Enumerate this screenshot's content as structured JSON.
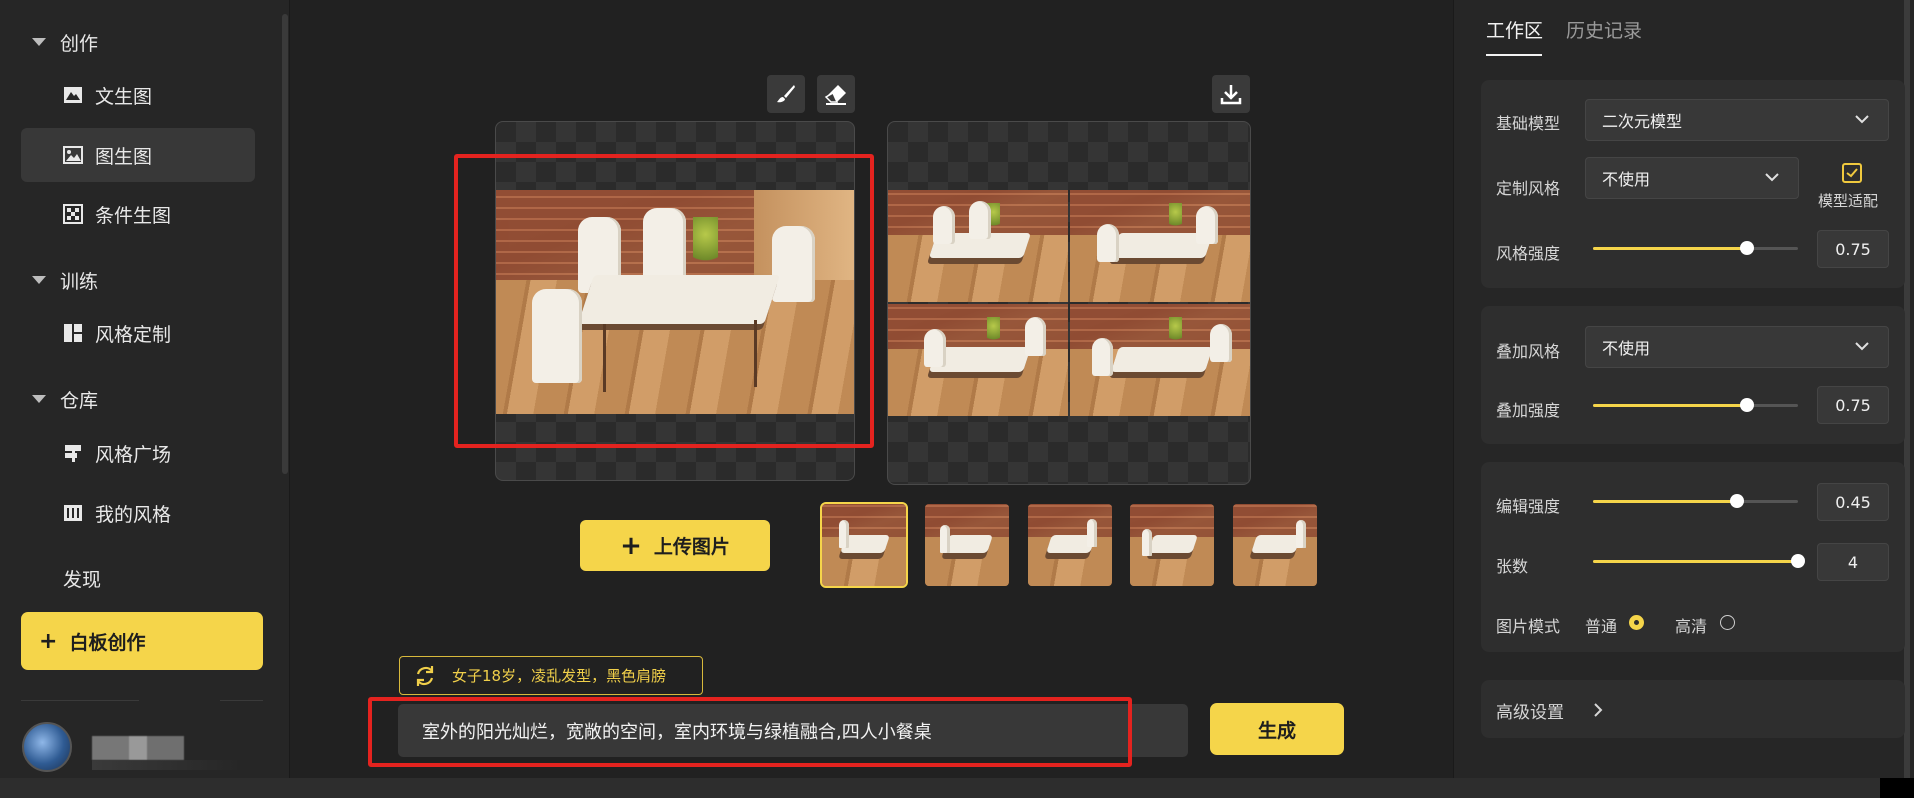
{
  "sidebar": {
    "groups": [
      {
        "label": "创作"
      },
      {
        "label": "训练"
      },
      {
        "label": "仓库"
      }
    ],
    "items": {
      "text_to_image": "文生图",
      "image_to_image": "图生图",
      "conditional": "条件生图",
      "style_custom": "风格定制",
      "style_square": "风格广场",
      "my_styles": "我的风格"
    },
    "discover": "发现",
    "whiteboard": {
      "plus": "+",
      "label": "白板创作"
    }
  },
  "canvas": {
    "upload": {
      "plus": "+",
      "label": "上传图片"
    },
    "suggestion": "女子18岁，凌乱发型，黑色肩膀",
    "prompt": "室外的阳光灿烂，宽敞的空间，室内环境与绿植融合,四人小餐桌",
    "generate": "生成",
    "thumbnails": [
      {
        "selected": true
      },
      {
        "selected": false
      },
      {
        "selected": false
      },
      {
        "selected": false
      },
      {
        "selected": false
      }
    ]
  },
  "right_panel": {
    "tabs": {
      "workspace": "工作区",
      "history": "历史记录"
    },
    "base_model": {
      "label": "基础模型",
      "value": "二次元模型"
    },
    "custom_style": {
      "label": "定制风格",
      "value": "不使用",
      "adapt_label": "模型适配",
      "adapt_checked": true
    },
    "style_strength": {
      "label": "风格强度",
      "value": "0.75",
      "fraction": 0.75
    },
    "overlay_style": {
      "label": "叠加风格",
      "value": "不使用"
    },
    "overlay_strength": {
      "label": "叠加强度",
      "value": "0.75",
      "fraction": 0.75
    },
    "edit_strength": {
      "label": "编辑强度",
      "value": "0.45",
      "fraction": 0.7
    },
    "count": {
      "label": "张数",
      "value": "4",
      "fraction": 1.0
    },
    "image_mode": {
      "label": "图片模式",
      "normal": "普通",
      "hd": "高清",
      "selected": "normal"
    },
    "advanced": "高级设置"
  },
  "colors": {
    "accent": "#f5d54a",
    "highlight_box": "#e4231f",
    "background": "#212121"
  }
}
